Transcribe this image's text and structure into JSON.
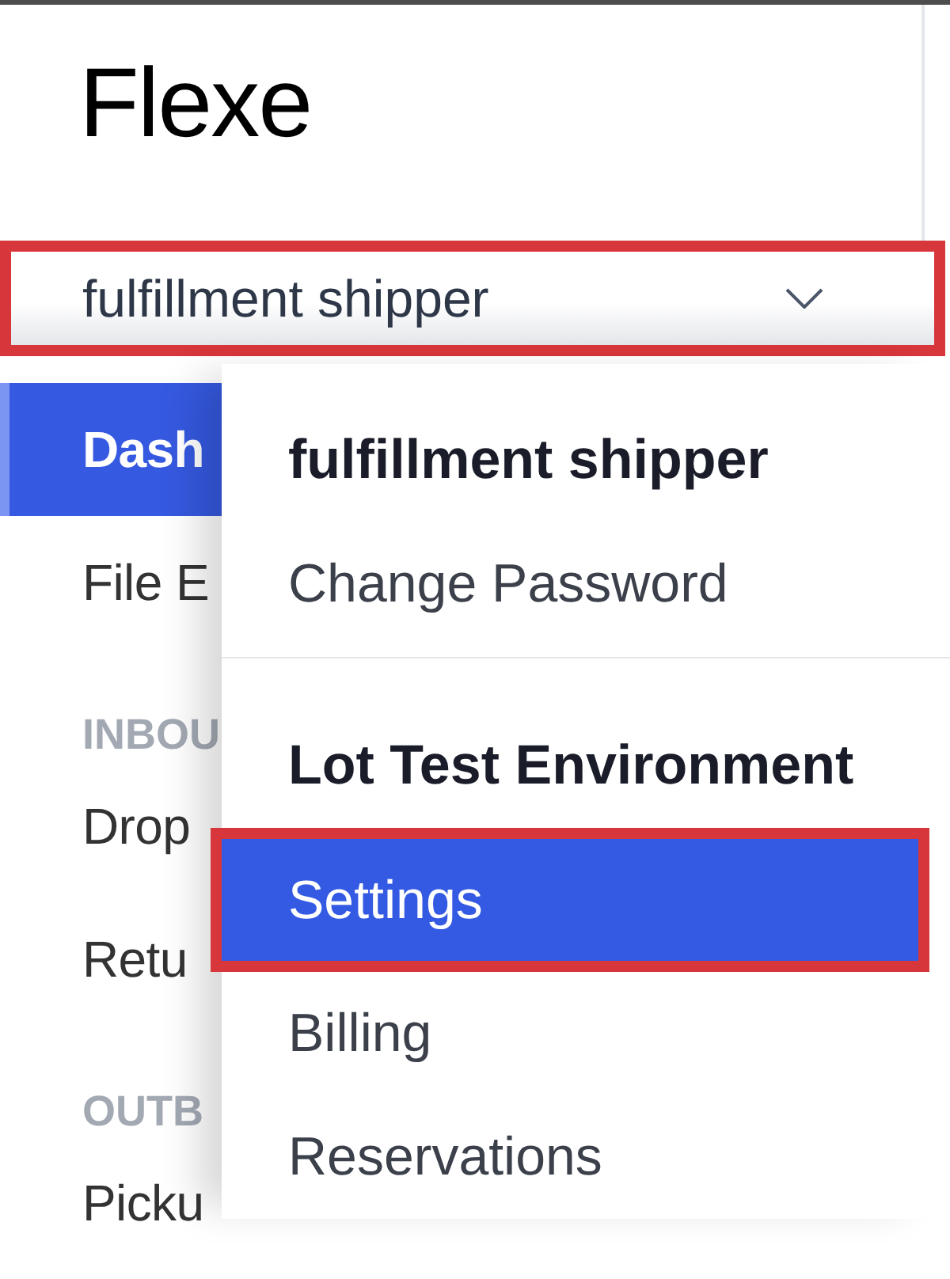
{
  "logo": "Flexe",
  "account_menu_button": {
    "label": "fulfillment shipper",
    "expanded": true,
    "annotated": true
  },
  "sidebar": {
    "items": [
      {
        "kind": "link",
        "label": "Dash",
        "selected": true
      },
      {
        "kind": "link",
        "label": "File E",
        "selected": false
      },
      {
        "kind": "section",
        "label": "INBOU"
      },
      {
        "kind": "link",
        "label": "Drop",
        "selected": false
      },
      {
        "kind": "link",
        "label": "Retu",
        "selected": false
      },
      {
        "kind": "section",
        "label": "OUTB"
      },
      {
        "kind": "link",
        "label": "Picku",
        "selected": false
      }
    ]
  },
  "dropdown_menu": {
    "items": [
      {
        "kind": "heading",
        "label": "fulfillment shipper"
      },
      {
        "kind": "item",
        "label": "Change Password",
        "selected": false,
        "annotated": false
      },
      {
        "kind": "divider"
      },
      {
        "kind": "heading",
        "label": "Lot Test Environment"
      },
      {
        "kind": "item",
        "label": "Settings",
        "selected": true,
        "annotated": true
      },
      {
        "kind": "item",
        "label": "Billing",
        "selected": false,
        "annotated": false
      },
      {
        "kind": "item",
        "label": "Reservations",
        "selected": false,
        "annotated": false
      }
    ]
  }
}
